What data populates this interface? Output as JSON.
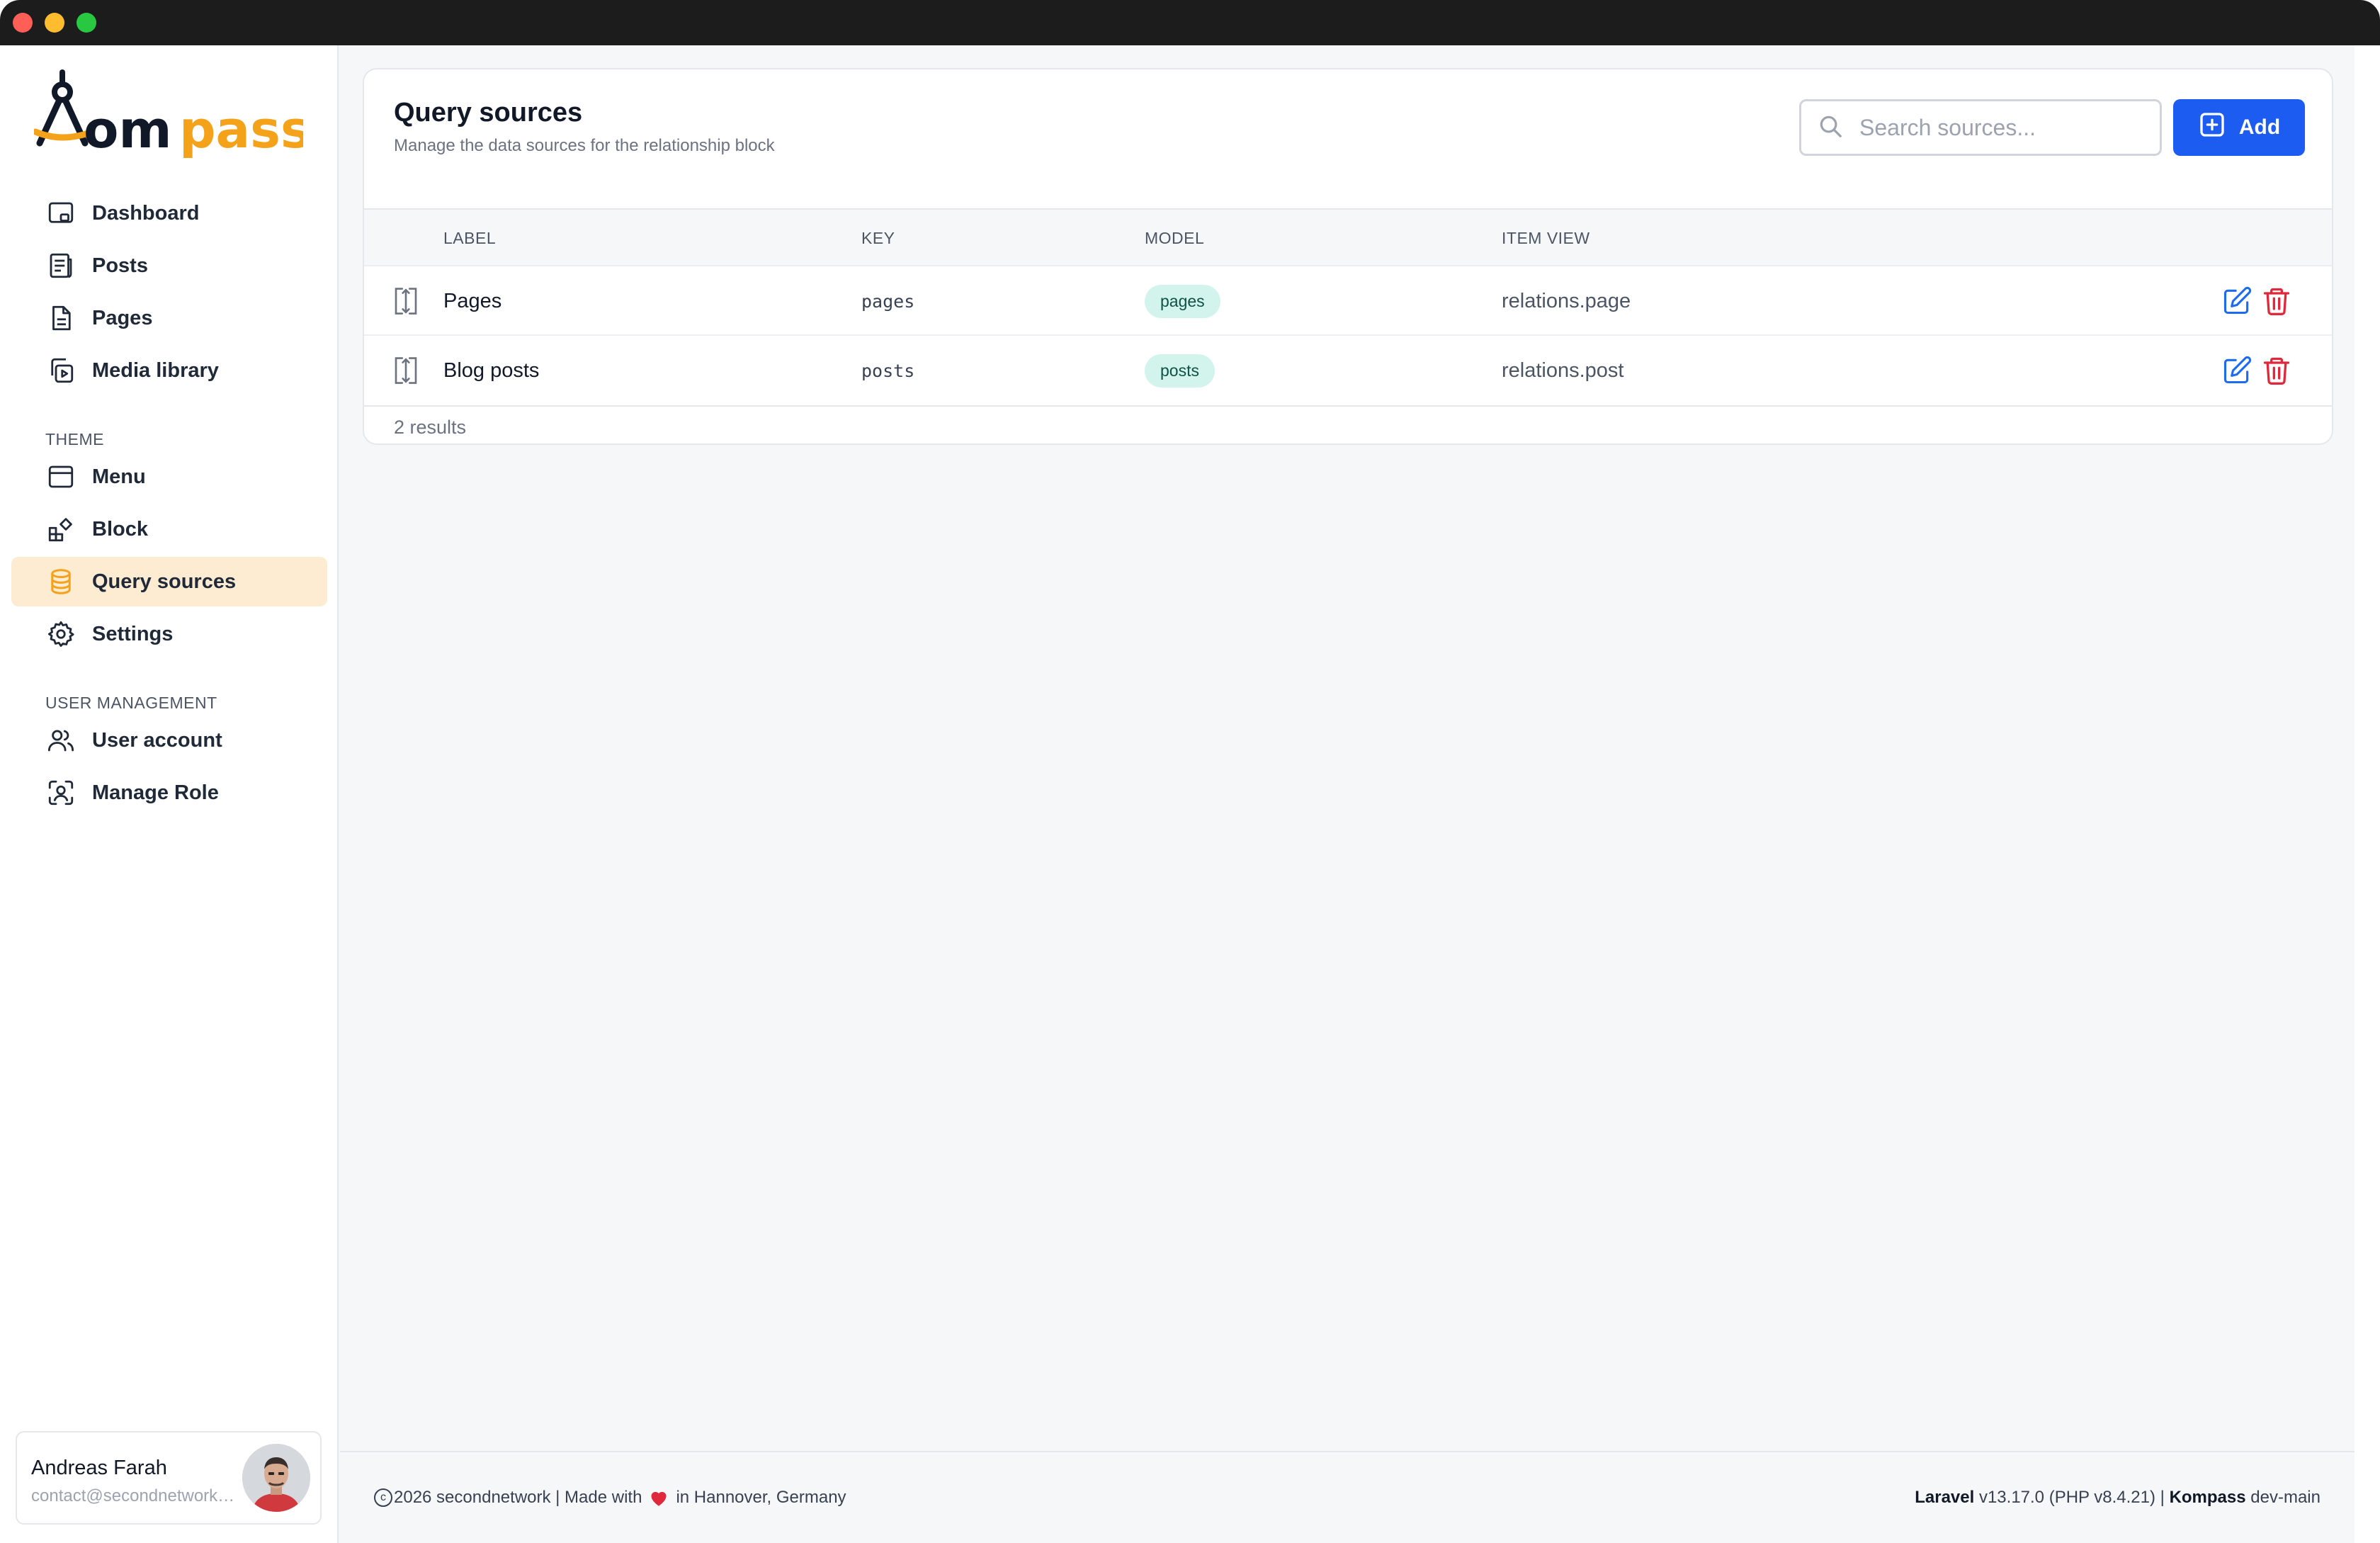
{
  "app": {
    "logo_text": "Kompass",
    "brand_color": "#f5a21b",
    "accent_color": "#1d5cf0"
  },
  "sidebar": {
    "items": [
      {
        "label": "Dashboard",
        "icon": "dashboard-icon"
      },
      {
        "label": "Posts",
        "icon": "posts-icon"
      },
      {
        "label": "Pages",
        "icon": "pages-icon"
      },
      {
        "label": "Media library",
        "icon": "media-icon"
      }
    ],
    "theme_section": "THEME",
    "theme_items": [
      {
        "label": "Menu",
        "icon": "menu-icon"
      },
      {
        "label": "Block",
        "icon": "block-icon"
      },
      {
        "label": "Query sources",
        "icon": "database-icon",
        "active": true
      },
      {
        "label": "Settings",
        "icon": "gear-icon"
      }
    ],
    "user_section": "USER MANAGEMENT",
    "user_items": [
      {
        "label": "User account",
        "icon": "users-icon"
      },
      {
        "label": "Manage Role",
        "icon": "role-icon"
      }
    ],
    "user": {
      "name": "Andreas Farah",
      "email": "contact@secondnetwork.de"
    }
  },
  "main": {
    "title": "Query sources",
    "subtitle": "Manage the data sources for the relationship block",
    "search_placeholder": "Search sources...",
    "add_label": "Add",
    "columns": [
      "LABEL",
      "KEY",
      "MODEL",
      "ITEM VIEW"
    ],
    "rows": [
      {
        "label": "Pages",
        "key": "pages",
        "model": "pages",
        "item_view": "relations.page"
      },
      {
        "label": "Blog posts",
        "key": "posts",
        "model": "posts",
        "item_view": "relations.post"
      }
    ],
    "result_count": "2 results"
  },
  "footer": {
    "copyright": "2026 secondnetwork | Made with",
    "location": "in Hannover, Germany",
    "laravel_label": "Laravel",
    "laravel_version": "v13.17.0 (PHP v8.4.21) |",
    "kompass_label": "Kompass",
    "kompass_version": "dev-main"
  }
}
